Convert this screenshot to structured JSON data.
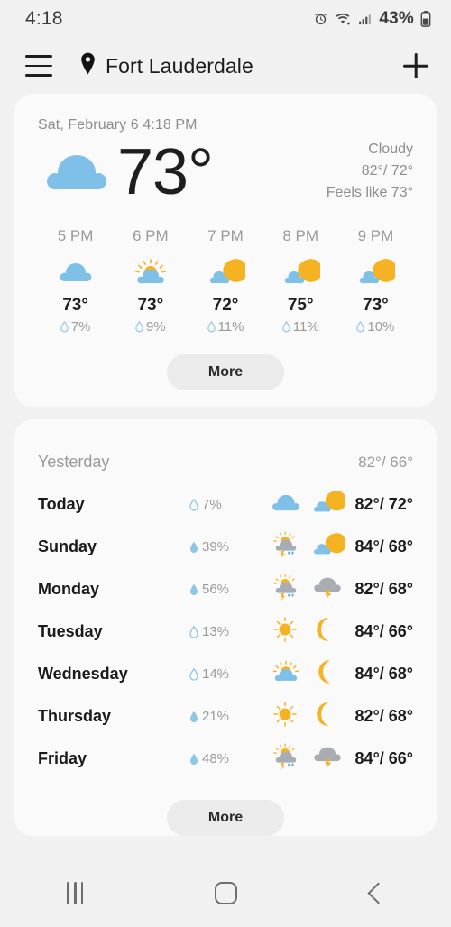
{
  "status_bar": {
    "time": "4:18",
    "battery_percent": "43%",
    "icons": [
      "alarm-icon",
      "wifi-icon",
      "signal-icon",
      "battery-icon"
    ]
  },
  "app_bar": {
    "menu_icon": "hamburger-menu-icon",
    "location_icon": "location-pin-icon",
    "city": "Fort Lauderdale",
    "add_icon": "plus-icon"
  },
  "current": {
    "datetime": "Sat, February 6 4:18 PM",
    "temperature": "73°",
    "icon": "cloudy-icon",
    "condition": "Cloudy",
    "high_low": "82°/ 72°",
    "feels_like": "Feels like 73°"
  },
  "hourly": {
    "more_label": "More",
    "items": [
      {
        "time": "5 PM",
        "icon": "cloudy-icon",
        "temp": "73°",
        "precip": "7%"
      },
      {
        "time": "6 PM",
        "icon": "partly-sunny-icon",
        "temp": "73°",
        "precip": "9%"
      },
      {
        "time": "7 PM",
        "icon": "partly-cloudy-night-icon",
        "temp": "72°",
        "precip": "11%"
      },
      {
        "time": "8 PM",
        "icon": "partly-cloudy-night-icon",
        "temp": "75°",
        "precip": "11%"
      },
      {
        "time": "9 PM",
        "icon": "partly-cloudy-night-icon",
        "temp": "73°",
        "precip": "10%"
      }
    ]
  },
  "daily": {
    "more_label": "More",
    "yesterday": {
      "label": "Yesterday",
      "high_low": "82°/ 66°"
    },
    "rows": [
      {
        "day": "Today",
        "precip": "7%",
        "day_icon": "cloudy-icon",
        "night_icon": "partly-cloudy-night-icon",
        "high_low": "82°/ 72°"
      },
      {
        "day": "Sunday",
        "precip": "39%",
        "day_icon": "sun-thunderstorm-icon",
        "night_icon": "partly-cloudy-night-icon",
        "high_low": "84°/ 68°"
      },
      {
        "day": "Monday",
        "precip": "56%",
        "day_icon": "sun-thunderstorm-icon",
        "night_icon": "thunderstorm-cloud-icon",
        "high_low": "82°/ 68°"
      },
      {
        "day": "Tuesday",
        "precip": "13%",
        "day_icon": "sunny-icon",
        "night_icon": "clear-night-icon",
        "high_low": "84°/ 66°"
      },
      {
        "day": "Wednesday",
        "precip": "14%",
        "day_icon": "partly-sunny-icon",
        "night_icon": "clear-night-icon",
        "high_low": "84°/ 68°"
      },
      {
        "day": "Thursday",
        "precip": "21%",
        "day_icon": "sunny-icon",
        "night_icon": "clear-night-icon",
        "high_low": "82°/ 68°"
      },
      {
        "day": "Friday",
        "precip": "48%",
        "day_icon": "sun-thunderstorm-icon",
        "night_icon": "thunderstorm-cloud-icon",
        "high_low": "84°/ 66°"
      }
    ]
  },
  "nav_bar": {
    "recents": "recents-icon",
    "home": "home-icon",
    "back": "back-icon"
  },
  "colors": {
    "background": "#f1f1f1",
    "card": "#fafafa",
    "text_primary": "#1b1b1b",
    "text_secondary": "#9a9a9a",
    "cloud_blue": "#7fc0e8",
    "sun_yellow": "#f5b324",
    "storm_grey": "#a8adb3",
    "droplet_blue": "#8ec7e6"
  }
}
